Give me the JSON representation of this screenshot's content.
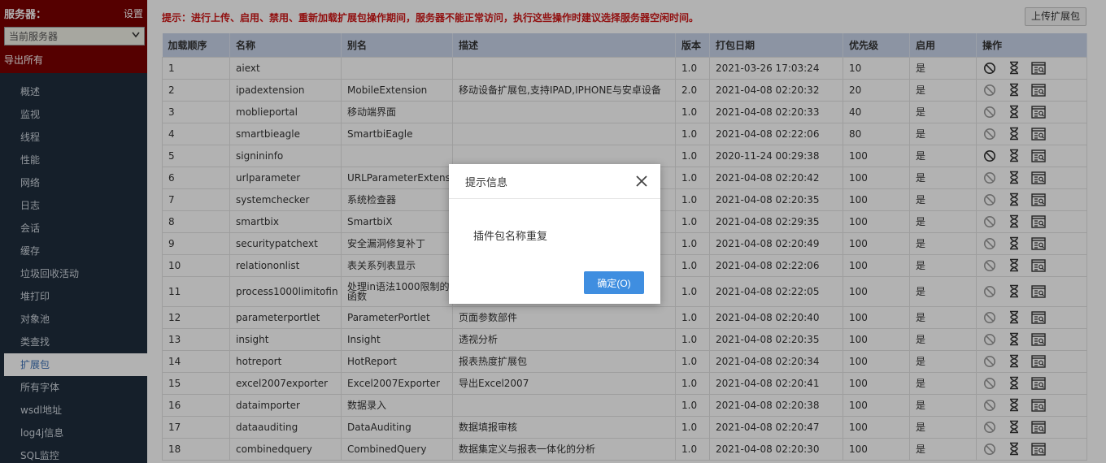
{
  "sidebar": {
    "server_label": "服务器：",
    "settings": "设置",
    "server_select": "当前服务器",
    "export_all": "导出所有",
    "items": [
      {
        "label": "概述",
        "name": "overview"
      },
      {
        "label": "监视",
        "name": "monitor"
      },
      {
        "label": "线程",
        "name": "threads"
      },
      {
        "label": "性能",
        "name": "performance"
      },
      {
        "label": "网络",
        "name": "network"
      },
      {
        "label": "日志",
        "name": "logs"
      },
      {
        "label": "会话",
        "name": "sessions"
      },
      {
        "label": "缓存",
        "name": "cache"
      },
      {
        "label": "垃圾回收活动",
        "name": "gc-activity"
      },
      {
        "label": "堆打印",
        "name": "heap-print"
      },
      {
        "label": "对象池",
        "name": "object-pool"
      },
      {
        "label": "类查找",
        "name": "class-lookup"
      },
      {
        "label": "扩展包",
        "name": "extensions",
        "active": true
      },
      {
        "label": "所有字体",
        "name": "all-fonts"
      },
      {
        "label": "wsdl地址",
        "name": "wsdl-address"
      },
      {
        "label": "log4j信息",
        "name": "log4j-info"
      },
      {
        "label": "SQL监控",
        "name": "sql-monitor"
      }
    ]
  },
  "main": {
    "notice": "提示：进行上传、启用、禁用、重新加载扩展包操作期间，服务器不能正常访问，执行这些操作时建议选择服务器空闲时间。",
    "upload_button": "上传扩展包",
    "columns": [
      "加载顺序",
      "名称",
      "别名",
      "描述",
      "版本",
      "打包日期",
      "优先级",
      "启用",
      "操作"
    ],
    "rows": [
      {
        "order": "1",
        "name": "aiext",
        "alias": "",
        "desc": "",
        "version": "1.0",
        "date": "2021-03-26 17:03:24",
        "priority": "10",
        "enabled": "是"
      },
      {
        "order": "2",
        "name": "ipadextension",
        "alias": "MobileExtension",
        "desc": "移动设备扩展包,支持IPAD,IPHONE与安卓设备",
        "version": "2.0",
        "date": "2021-04-08 02:20:32",
        "priority": "20",
        "enabled": "是"
      },
      {
        "order": "3",
        "name": "moblieportal",
        "alias": "移动端界面",
        "desc": "",
        "version": "1.0",
        "date": "2021-04-08 02:20:33",
        "priority": "40",
        "enabled": "是"
      },
      {
        "order": "4",
        "name": "smartbieagle",
        "alias": "SmartbiEagle",
        "desc": "",
        "version": "1.0",
        "date": "2021-04-08 02:22:06",
        "priority": "80",
        "enabled": "是"
      },
      {
        "order": "5",
        "name": "signininfo",
        "alias": "",
        "desc": "",
        "version": "1.0",
        "date": "2020-11-24 00:29:38",
        "priority": "100",
        "enabled": "是"
      },
      {
        "order": "6",
        "name": "urlparameter",
        "alias": "URLParameterExtension",
        "desc": "",
        "version": "1.0",
        "date": "2021-04-08 02:20:42",
        "priority": "100",
        "enabled": "是"
      },
      {
        "order": "7",
        "name": "systemchecker",
        "alias": "系统检查器",
        "desc": "",
        "version": "1.0",
        "date": "2021-04-08 02:20:35",
        "priority": "100",
        "enabled": "是"
      },
      {
        "order": "8",
        "name": "smartbix",
        "alias": "SmartbiX",
        "desc": "",
        "version": "1.0",
        "date": "2021-04-08 02:29:35",
        "priority": "100",
        "enabled": "是"
      },
      {
        "order": "9",
        "name": "securitypatchext",
        "alias": "安全漏洞修复补丁",
        "desc": "",
        "version": "1.0",
        "date": "2021-04-08 02:20:49",
        "priority": "100",
        "enabled": "是"
      },
      {
        "order": "10",
        "name": "relationonlist",
        "alias": "表关系列表显示",
        "desc": "",
        "version": "1.0",
        "date": "2021-04-08 02:22:06",
        "priority": "100",
        "enabled": "是"
      },
      {
        "order": "11",
        "name": "process1000limitofin",
        "alias": "处理in语法1000限制的函数",
        "desc": "",
        "version": "1.0",
        "date": "2021-04-08 02:22:05",
        "priority": "100",
        "enabled": "是",
        "tall": true
      },
      {
        "order": "12",
        "name": "parameterportlet",
        "alias": "ParameterPortlet",
        "desc": "页面参数部件",
        "version": "1.0",
        "date": "2021-04-08 02:20:40",
        "priority": "100",
        "enabled": "是"
      },
      {
        "order": "13",
        "name": "insight",
        "alias": "Insight",
        "desc": "透视分析",
        "version": "1.0",
        "date": "2021-04-08 02:20:35",
        "priority": "100",
        "enabled": "是"
      },
      {
        "order": "14",
        "name": "hotreport",
        "alias": "HotReport",
        "desc": "报表热度扩展包",
        "version": "1.0",
        "date": "2021-04-08 02:20:34",
        "priority": "100",
        "enabled": "是"
      },
      {
        "order": "15",
        "name": "excel2007exporter",
        "alias": "Excel2007Exporter",
        "desc": "导出Excel2007",
        "version": "1.0",
        "date": "2021-04-08 02:20:41",
        "priority": "100",
        "enabled": "是"
      },
      {
        "order": "16",
        "name": "dataimporter",
        "alias": "数据录入",
        "desc": "",
        "version": "1.0",
        "date": "2021-04-08 02:20:38",
        "priority": "100",
        "enabled": "是"
      },
      {
        "order": "17",
        "name": "dataauditing",
        "alias": "DataAuditing",
        "desc": "数据填报审核",
        "version": "1.0",
        "date": "2021-04-08 02:20:47",
        "priority": "100",
        "enabled": "是"
      },
      {
        "order": "18",
        "name": "combinedquery",
        "alias": "CombinedQuery",
        "desc": "数据集定义与报表一体化的分析",
        "version": "1.0",
        "date": "2021-04-08 02:20:30",
        "priority": "100",
        "enabled": "是"
      }
    ],
    "op_icons": [
      "disable-icon",
      "reload-hourglass-icon",
      "detail-icon"
    ]
  },
  "modal": {
    "title": "提示信息",
    "message": "插件包名称重复",
    "ok_button": "确定(O)"
  },
  "colors": {
    "sidebar_bg": "#1f2d3d",
    "server_panel_bg": "#7a0000",
    "notice": "#d01818",
    "header_bg": "#c9d5ea",
    "primary_button": "#3f8ee0"
  }
}
